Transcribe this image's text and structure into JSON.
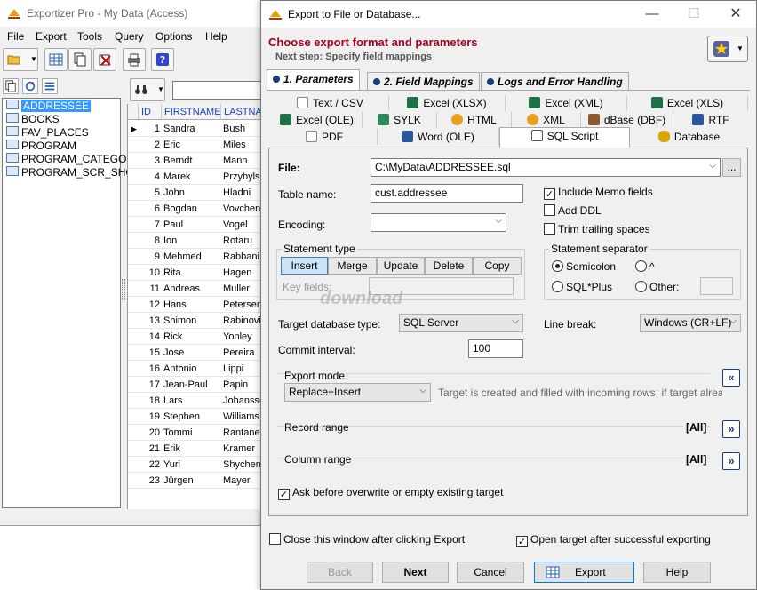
{
  "main": {
    "title": "Exportizer Pro - My Data (Access)",
    "menu": [
      "File",
      "Export",
      "Tools",
      "Query",
      "Options",
      "Help"
    ],
    "tables": [
      {
        "name": "ADDRESSEE",
        "selected": true
      },
      {
        "name": "BOOKS"
      },
      {
        "name": "FAV_PLACES"
      },
      {
        "name": "PROGRAM"
      },
      {
        "name": "PROGRAM_CATEGORY"
      },
      {
        "name": "PROGRAM_SCR_SHOT"
      }
    ],
    "grid": {
      "columns": [
        "ID",
        "FIRSTNAME",
        "LASTNAM"
      ],
      "rows": [
        [
          "1",
          "Sandra",
          "Bush"
        ],
        [
          "2",
          "Eric",
          "Miles"
        ],
        [
          "3",
          "Berndt",
          "Mann"
        ],
        [
          "4",
          "Marek",
          "Przybylsk"
        ],
        [
          "5",
          "John",
          "Hladni"
        ],
        [
          "6",
          "Bogdan",
          "Vovchenk"
        ],
        [
          "7",
          "Paul",
          "Vogel"
        ],
        [
          "8",
          "Ion",
          "Rotaru"
        ],
        [
          "9",
          "Mehmed",
          "Rabbani"
        ],
        [
          "10",
          "Rita",
          "Hagen"
        ],
        [
          "11",
          "Andreas",
          "Muller"
        ],
        [
          "12",
          "Hans",
          "Petersen"
        ],
        [
          "13",
          "Shimon",
          "Rabinovic"
        ],
        [
          "14",
          "Rick",
          "Yonley"
        ],
        [
          "15",
          "Jose",
          "Pereira"
        ],
        [
          "16",
          "Antonio",
          "Lippi"
        ],
        [
          "17",
          "Jean-Paul",
          "Papin"
        ],
        [
          "18",
          "Lars",
          "Johansso"
        ],
        [
          "19",
          "Stephen",
          "Williams"
        ],
        [
          "20",
          "Tommi",
          "Rantanen"
        ],
        [
          "21",
          "Erik",
          "Kramer"
        ],
        [
          "22",
          "Yuri",
          "Shychenk"
        ],
        [
          "23",
          "Jürgen",
          "Mayer"
        ]
      ]
    }
  },
  "dialog": {
    "title": "Export to File or Database...",
    "heading": "Choose export format and parameters",
    "subheading": "Next step: Specify field mappings",
    "steps": [
      "1. Parameters",
      "2. Field Mappings",
      "Logs and Error Handling"
    ],
    "formats_row1": [
      "Text / CSV",
      "Excel (XLSX)",
      "Excel (XML)",
      "Excel (XLS)"
    ],
    "formats_row2": [
      "Excel (OLE)",
      "SYLK",
      "HTML",
      "XML",
      "dBase (DBF)",
      "RTF"
    ],
    "formats_row3": [
      "PDF",
      "Word (OLE)",
      "SQL Script",
      "Database"
    ],
    "active_format": "SQL Script",
    "file_label": "File:",
    "file_value": "C:\\MyData\\ADDRESSEE.sql",
    "browse_label": "...",
    "table_name_label": "Table name:",
    "table_name_value": "cust.addressee",
    "encoding_label": "Encoding:",
    "encoding_value": "",
    "include_memo": {
      "label": "Include Memo fields",
      "checked": true
    },
    "add_ddl": {
      "label": "Add DDL",
      "checked": false
    },
    "trim_trailing": {
      "label": "Trim trailing spaces",
      "checked": false
    },
    "statement_type_label": "Statement type",
    "statement_types": [
      "Insert",
      "Merge",
      "Update",
      "Delete",
      "Copy"
    ],
    "statement_type_selected": "Insert",
    "key_fields_label": "Key fields:",
    "statement_separator_label": "Statement separator",
    "separators": {
      "semicolon": "Semicolon",
      "caret": "^",
      "sqlplus": "SQL*Plus",
      "other": "Other:"
    },
    "separator_selected": "Semicolon",
    "target_db_label": "Target database type:",
    "target_db_value": "SQL Server",
    "line_break_label": "Line break:",
    "line_break_value": "Windows (CR+LF)",
    "commit_label": "Commit interval:",
    "commit_value": "100",
    "export_mode_label": "Export mode",
    "export_mode_value": "Replace+Insert",
    "export_mode_hint": "Target is created and filled with incoming rows; if target already...",
    "record_range_label": "Record range",
    "record_range_value": "[All]",
    "column_range_label": "Column range",
    "column_range_value": "[All]",
    "ask_overwrite": {
      "label": "Ask before overwrite or empty existing target",
      "checked": true
    },
    "close_after": {
      "label": "Close this window after clicking Export",
      "checked": false
    },
    "open_after": {
      "label": "Open target after successful exporting",
      "checked": true
    },
    "buttons": {
      "back": "Back",
      "next": "Next",
      "cancel": "Cancel",
      "export": "Export",
      "help": "Help"
    },
    "watermark": "download"
  }
}
